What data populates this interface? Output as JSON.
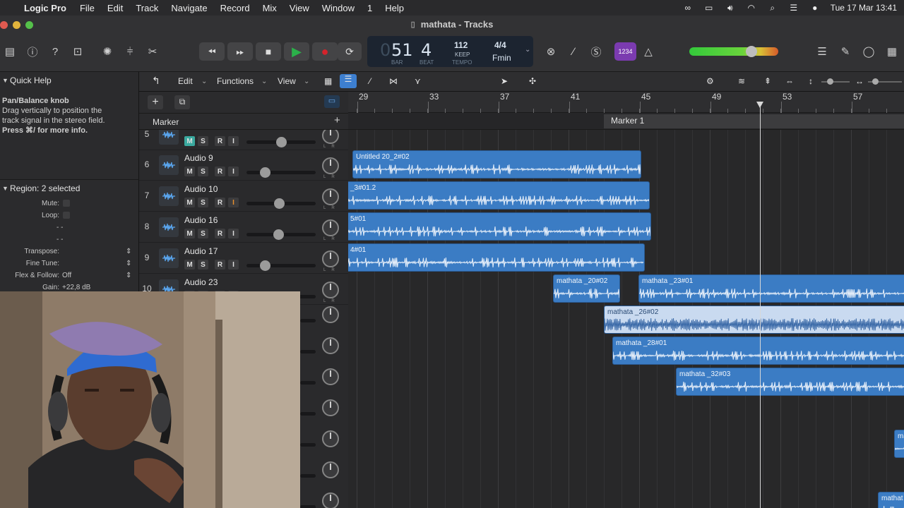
{
  "menubar": {
    "app_name": "Logic Pro",
    "items": [
      "File",
      "Edit",
      "Track",
      "Navigate",
      "Record",
      "Mix",
      "View",
      "Window",
      "1",
      "Help"
    ],
    "clock": "Tue 17 Mar  13:41"
  },
  "window": {
    "title": "mathata  - Tracks"
  },
  "lcd": {
    "bar_partial": "0",
    "bar": "51",
    "beat": "4",
    "bar_label": "BAR",
    "beat_label": "BEAT",
    "tempo": "112",
    "tempo_mode": "KEEP",
    "tempo_label": "TEMPO",
    "signature": "4/4",
    "key": "Fmin"
  },
  "toolbar": {
    "count_in": "1234"
  },
  "colors": {
    "region": "#3b7cc4",
    "selected_region": "#c9daf0",
    "mute_active": "#3aa99f",
    "record_red": "#d4232b",
    "play_green": "#2bb14a"
  },
  "inspector": {
    "quick_help_title": "Quick Help",
    "help_heading": "Pan/Balance knob",
    "help_body": "Drag vertically to position the track signal in the stereo field.",
    "help_more": "Press ⌘/ for more info.",
    "region_title": "Region: 2 selected",
    "rows": {
      "mute": "Mute:",
      "loop": "Loop:",
      "dash1": "- -",
      "dash2": "- -",
      "transpose": "Transpose:",
      "fine_tune": "Fine Tune:",
      "flex_label": "Flex & Follow:",
      "flex_value": "Off",
      "gain_label": "Gain:",
      "gain_value": "+22,8 dB"
    }
  },
  "track_toolbar": {
    "edit": "Edit",
    "functions": "Functions",
    "view": "View"
  },
  "marker_header": "Marker",
  "marker_name": "Marker 1",
  "ruler_bars": [
    "29",
    "33",
    "37",
    "41",
    "45",
    "49",
    "53",
    "57"
  ],
  "mute_labels": {
    "m": "M",
    "s": "S",
    "r": "R",
    "i": "I"
  },
  "tracks": [
    {
      "num": "5",
      "name": "",
      "fader": 0.5,
      "mute": true
    },
    {
      "num": "6",
      "name": "Audio 9",
      "fader": 0.27,
      "mute": false
    },
    {
      "num": "7",
      "name": "Audio 10",
      "fader": 0.47,
      "mute": false
    },
    {
      "num": "8",
      "name": "Audio 16",
      "fader": 0.46,
      "mute": false
    },
    {
      "num": "9",
      "name": "Audio 17",
      "fader": 0.27,
      "mute": false
    },
    {
      "num": "10",
      "name": "Audio 23",
      "fader": 0.6,
      "mute": false
    }
  ],
  "regions": [
    {
      "name": "Untitled 20_2#02"
    },
    {
      "name": "_3#01.2"
    },
    {
      "name": "5#01"
    },
    {
      "name": "4#01"
    },
    {
      "name": "mathata _20#02"
    },
    {
      "name": "mathata _23#01"
    },
    {
      "name": "mathata _26#02"
    },
    {
      "name": "mathata _28#01"
    },
    {
      "name": "mathata _32#03"
    },
    {
      "name": "mathata"
    },
    {
      "name": "mathat"
    }
  ]
}
